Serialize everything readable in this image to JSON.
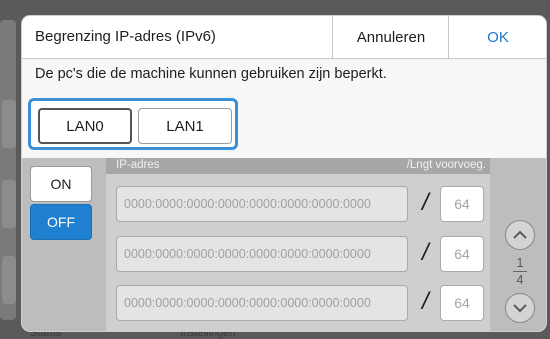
{
  "background": {
    "left_labels": [
      "",
      ""
    ],
    "bottom_labels": [
      "Status",
      "Instellingen"
    ]
  },
  "dialog": {
    "title": "Begrenzing IP-adres (IPv6)",
    "cancel_label": "Annuleren",
    "ok_label": "OK",
    "description": "De pc's die de machine kunnen gebruiken zijn beperkt."
  },
  "lan_tabs": [
    {
      "label": "LAN0",
      "selected": true
    },
    {
      "label": "LAN1",
      "selected": false
    }
  ],
  "toggle": {
    "on_label": "ON",
    "off_label": "OFF",
    "selected": "OFF"
  },
  "table": {
    "col_ip": "IP-adres",
    "col_prefix": "/Lngt voorvoeg.",
    "rows": [
      {
        "ip": "0000:0000:0000:0000:0000:0000:0000:0000",
        "sep": "/",
        "prefix": "64"
      },
      {
        "ip": "0000:0000:0000:0000:0000:0000:0000:0000",
        "sep": "/",
        "prefix": "64"
      },
      {
        "ip": "0000:0000:0000:0000:0000:0000:0000:0000",
        "sep": "/",
        "prefix": "64"
      }
    ]
  },
  "pager": {
    "current": "1",
    "total": "4"
  },
  "colors": {
    "accent": "#1f80d0",
    "focus_border": "#3a8fd6",
    "ok_text": "#1b76c9"
  },
  "icons": {
    "up": "chevron-up-icon",
    "down": "chevron-down-icon"
  }
}
